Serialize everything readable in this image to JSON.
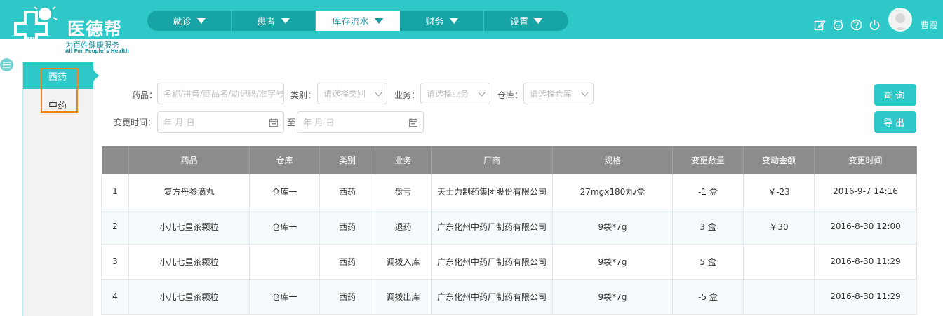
{
  "app": {
    "title": "医德帮",
    "slogan": "为百姓健康服务",
    "slogan_en": "All For People`s Health"
  },
  "nav": [
    {
      "label": "就诊",
      "active": false
    },
    {
      "label": "患者",
      "active": false
    },
    {
      "label": "库存流水",
      "active": true
    },
    {
      "label": "财务",
      "active": false
    },
    {
      "label": "设置",
      "active": false
    }
  ],
  "toolbar_icons": [
    "edit-icon",
    "alarm-icon",
    "help-icon",
    "power-icon"
  ],
  "user": {
    "name": "曹霞"
  },
  "subnav": [
    {
      "label": "西药",
      "active": true
    },
    {
      "label": "中药",
      "active": false
    }
  ],
  "filters": {
    "drug_label": "药品：",
    "drug_placeholder": "名称/拼音/商品名/助记码/准字号",
    "category_label": "类别：",
    "category_placeholder": "请选择类别",
    "business_label": "业务：",
    "business_placeholder": "请选择业务",
    "warehouse_label": "仓库：",
    "warehouse_placeholder": "请选择仓库",
    "time_label": "变更时间：",
    "date_from_placeholder": "年-月-日",
    "date_to_label": "至",
    "date_to_placeholder": "年-月-日"
  },
  "buttons": {
    "query": "查询",
    "export": "导出"
  },
  "table": {
    "headers": [
      "",
      "药品",
      "仓库",
      "类别",
      "业务",
      "厂商",
      "规格",
      "变更数量",
      "变动金额",
      "变更时间"
    ],
    "rows": [
      [
        "1",
        "复方丹参滴丸",
        "仓库一",
        "西药",
        "盘亏",
        "天士力制药集团股份有限公司",
        "27mgx180丸/盒",
        "-1 盒",
        "￥-23",
        "2016-9-7 14:16"
      ],
      [
        "2",
        "小儿七星茶颗粒",
        "仓库一",
        "西药",
        "退药",
        "广东化州中药厂制药有限公司",
        "9袋*7g",
        "3 盒",
        "￥30",
        "2016-8-30 12:00"
      ],
      [
        "3",
        "小儿七星茶颗粒",
        "",
        "西药",
        "调拨入库",
        "广东化州中药厂制药有限公司",
        "9袋*7g",
        "5 盒",
        "",
        "2016-8-30 11:29"
      ],
      [
        "4",
        "小儿七星茶颗粒",
        "仓库一",
        "西药",
        "调拨出库",
        "广东化州中药厂制药有限公司",
        "9袋*7g",
        "-5 盒",
        "",
        "2016-8-30 11:29"
      ]
    ]
  },
  "colors": {
    "brand": "#2ec8c8",
    "nav_bg": "#17a4a4",
    "highlight": "#f08120",
    "table_header": "#8c8c8c"
  }
}
